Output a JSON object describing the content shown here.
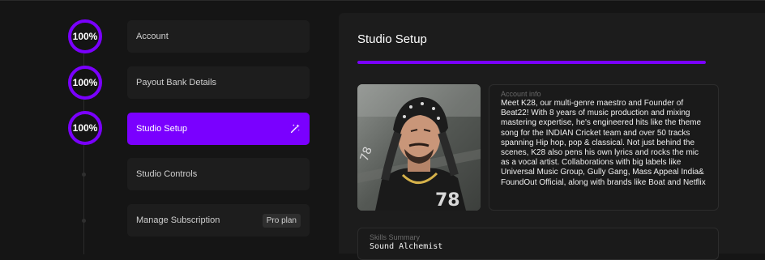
{
  "steps": [
    {
      "label": "Account",
      "percent": "100%",
      "completed": true,
      "active": false
    },
    {
      "label": "Payout Bank Details",
      "percent": "100%",
      "completed": true,
      "active": false
    },
    {
      "label": "Studio Setup",
      "percent": "100%",
      "completed": true,
      "active": true,
      "icon": "magic-wand-icon"
    },
    {
      "label": "Studio Controls",
      "completed": false,
      "active": false
    },
    {
      "label": "Manage Subscription",
      "completed": false,
      "active": false,
      "badge": "Pro plan"
    }
  ],
  "panel": {
    "title": "Studio Setup",
    "progress_percent": 100,
    "account_info": {
      "label": "Account info",
      "text": "Meet K28, our multi-genre maestro and Founder of Beat22! With 8 years of music production and mixing mastering expertise, he's engineered hits like the theme song for the INDIAN Cricket team and over 50 tracks spanning Hip hop, pop & classical. Not just behind the scenes, K28 also pens his own lyrics and rocks the mic as a vocal artist. Collaborations with big labels like Universal Music Group, Gully Gang, Mass Appeal India& FoundOut Official, along with brands like Boat and Netflix"
    },
    "skills": {
      "label": "Skills Summary",
      "value": "Sound Alchemist"
    }
  },
  "colors": {
    "accent": "#7a00ff",
    "background": "#151515",
    "card": "#1d1d1d"
  }
}
